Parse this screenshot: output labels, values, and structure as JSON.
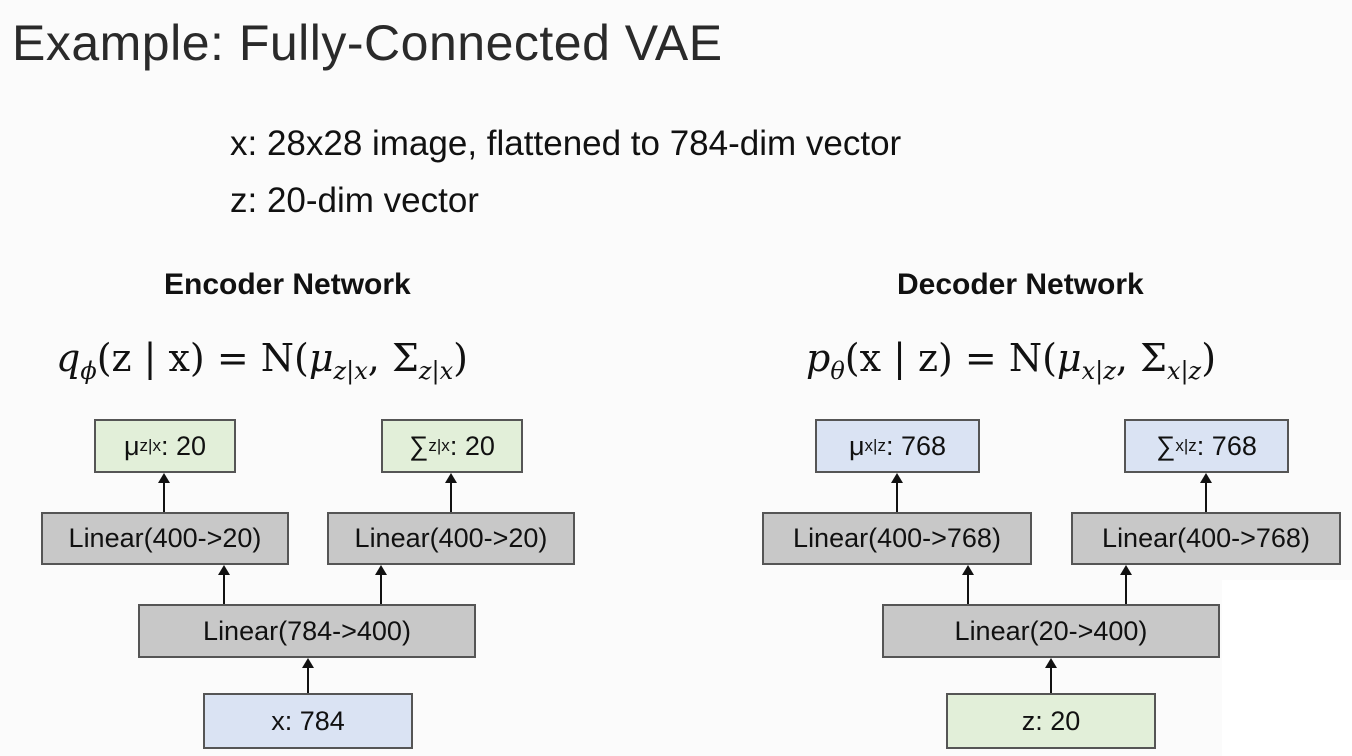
{
  "title": "Example: Fully-Connected VAE",
  "bullets": [
    "x: 28x28 image, flattened to 784-dim vector",
    "z: 20-dim vector"
  ],
  "encoder": {
    "title": "Encoder Network",
    "formula": {
      "q": "q",
      "phi": "ϕ",
      "lhs_args": "(z | x) = N(",
      "mu": "μ",
      "mu_sub": "z|x",
      "comma": ", ",
      "sigma": "Σ",
      "sigma_sub": "z|x",
      "close": ")"
    },
    "mu_box": {
      "symbol": "μ",
      "sub": "z|x",
      "value": ": 20"
    },
    "sigma_box": {
      "symbol": "∑",
      "sub": "z|x",
      "value": ": 20"
    },
    "linear_mu": "Linear(400->20)",
    "linear_sigma": "Linear(400->20)",
    "linear_hidden": "Linear(784->400)",
    "input": "x: 784"
  },
  "decoder": {
    "title": "Decoder Network",
    "formula": {
      "p": "p",
      "theta": "θ",
      "lhs_args": "(x | z) = N(",
      "mu": "μ",
      "mu_sub": "x|z",
      "comma": ", ",
      "sigma": "Σ",
      "sigma_sub": "x|z",
      "close": ")"
    },
    "mu_box": {
      "symbol": "μ",
      "sub": "x|z",
      "value": ": 768"
    },
    "sigma_box": {
      "symbol": "∑",
      "sub": "x|z",
      "value": ": 768"
    },
    "linear_mu": "Linear(400->768)",
    "linear_sigma": "Linear(400->768)",
    "linear_hidden": "Linear(20->400)",
    "input": "z: 20"
  },
  "colors": {
    "green_box": "#e2efd9",
    "blue_box": "#dae3f3",
    "gray_box": "#c8c8c8",
    "border": "#555555"
  }
}
